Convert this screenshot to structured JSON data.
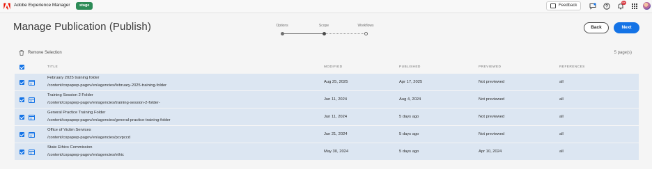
{
  "shell": {
    "app_title": "Adobe Experience Manager",
    "env_badge": "stage",
    "feedback_label": "Feedback",
    "notification_count": "9+"
  },
  "page": {
    "title": "Manage Publication (Publish)"
  },
  "wizard": {
    "steps": [
      {
        "label": "Options",
        "state": "completed"
      },
      {
        "label": "Scope",
        "state": "current"
      },
      {
        "label": "Workflows",
        "state": "upcoming"
      }
    ]
  },
  "actions": {
    "back_label": "Back",
    "next_label": "Next"
  },
  "toolbar": {
    "remove_selection_label": "Remove Selection",
    "page_count": "5 page(s)"
  },
  "table": {
    "columns": [
      "TITLE",
      "MODIFIED",
      "PUBLISHED",
      "PREVIEWED",
      "REFERENCES"
    ],
    "rows": [
      {
        "title": "February 2025 training folder",
        "path": "/content/copapwp-pagov/en/agencies/february-2025-training-folder",
        "modified": "Aug 25, 2025",
        "published": "Apr 17, 2025",
        "previewed": "Not previewed",
        "references": "all"
      },
      {
        "title": "Training Session 2 Folder",
        "path": "/content/copapwp-pagov/en/agencies/training-session-2-folder-",
        "modified": "Jun 11, 2024",
        "published": "Aug 4, 2024",
        "previewed": "Not previewed",
        "references": "all"
      },
      {
        "title": "General Practice Training Folder",
        "path": "/content/copapwp-pagov/en/agencies/general-practice-training-folder",
        "modified": "Jun 11, 2024",
        "published": "5 days ago",
        "previewed": "Not previewed",
        "references": "all"
      },
      {
        "title": "Office of Victim Services",
        "path": "/content/copapwp-pagov/en/agencies/pcvpccd",
        "modified": "Jun 21, 2024",
        "published": "5 days ago",
        "previewed": "Not previewed",
        "references": "all"
      },
      {
        "title": "State Ethics Commission",
        "path": "/content/copapwp-pagov/en/agencies/ethic",
        "modified": "May 30, 2024",
        "published": "5 days ago",
        "previewed": "Apr 10, 2024",
        "references": "all"
      }
    ]
  },
  "colors": {
    "accent": "#1473e6",
    "row_selected": "#dce6f2",
    "env_badge": "#2d8b57",
    "adobe_red": "#eb1000"
  },
  "icons": [
    "adobe-logo-icon",
    "feedback-icon",
    "chat-icon",
    "help-icon",
    "bell-icon",
    "apps-grid-icon",
    "trash-icon",
    "page-icon",
    "checkbox-icon"
  ]
}
